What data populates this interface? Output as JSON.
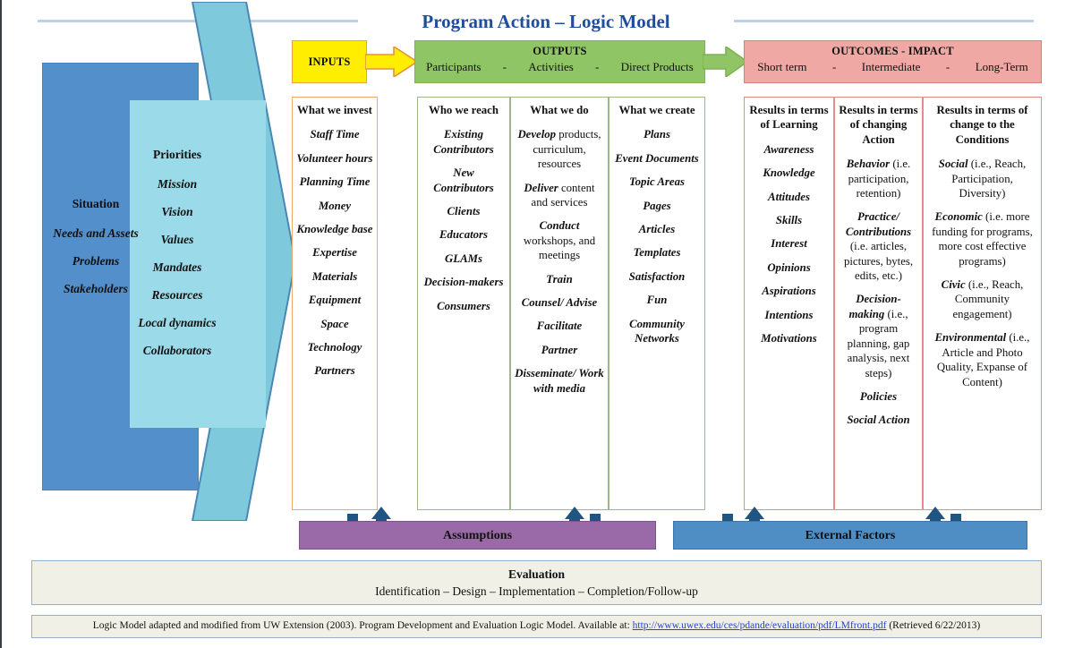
{
  "title": "Program Action – Logic Model",
  "situation": {
    "heading": "Situation",
    "items": [
      "Needs and Assets",
      "Problems",
      "Stakeholders"
    ]
  },
  "priorities": {
    "heading": "Priorities",
    "items": [
      "Mission",
      "Vision",
      "Values",
      "Mandates",
      "Resources",
      "Local dynamics",
      "Collaborators"
    ]
  },
  "headers": {
    "inputs": {
      "title": "INPUTS"
    },
    "outputs": {
      "title": "OUTPUTS",
      "sub": [
        "Participants",
        "-",
        "Activities",
        "-",
        "Direct Products"
      ]
    },
    "outcomes": {
      "title": "OUTCOMES - IMPACT",
      "sub": [
        "Short term",
        "-",
        "Intermediate",
        "-",
        "Long-Term"
      ]
    }
  },
  "columns": {
    "invest": {
      "heading": "What we invest",
      "items": [
        "Staff Time",
        "Volunteer hours",
        "Planning Time",
        "Money",
        "Knowledge base",
        "Expertise",
        "Materials",
        "Equipment",
        "Space",
        "Technology",
        "Partners"
      ]
    },
    "reach": {
      "heading": "Who we reach",
      "items": [
        "Existing Contributors",
        "New Contributors",
        "Clients",
        "Educators",
        "GLAMs",
        "Decision-makers",
        "Consumers"
      ]
    },
    "do": {
      "heading": "What we do",
      "items": [
        {
          "lead": "Develop",
          "rest": "products, curriculum, resources"
        },
        {
          "lead": "Deliver",
          "rest": "content and services"
        },
        {
          "lead": "Conduct",
          "rest": "workshops, and meetings"
        },
        {
          "lead": "Train",
          "rest": ""
        },
        {
          "lead": "Counsel/ Advise",
          "rest": ""
        },
        {
          "lead": "Facilitate",
          "rest": ""
        },
        {
          "lead": "Partner",
          "rest": ""
        },
        {
          "lead": "Disseminate/ Work with media",
          "rest": ""
        }
      ]
    },
    "create": {
      "heading": "What we create",
      "items": [
        "Plans",
        "Event Documents",
        "Topic Areas",
        "Pages",
        "Articles",
        "Templates",
        "Satisfaction",
        "Fun",
        "Community Networks"
      ]
    },
    "learning": {
      "heading": "Results in terms of Learning",
      "items": [
        "Awareness",
        "Knowledge",
        "Attitudes",
        "Skills",
        "Interest",
        "Opinions",
        "Aspirations",
        "Intentions",
        "Motivations"
      ]
    },
    "action": {
      "heading": "Results in terms of changing Action",
      "items": [
        {
          "lead": "Behavior",
          "rest": "(i.e. participation, retention)"
        },
        {
          "lead": "Practice/ Contributions",
          "rest": "(i.e. articles, pictures, bytes, edits, etc.)"
        },
        {
          "lead": "Decision-making",
          "rest": "(i.e., program planning, gap analysis, next steps)"
        },
        {
          "lead": "Policies",
          "rest": ""
        },
        {
          "lead": "Social Action",
          "rest": ""
        }
      ]
    },
    "conditions": {
      "heading": "Results in terms of change to the Conditions",
      "items": [
        {
          "lead": "Social",
          "rest": "(i.e.,  Reach, Participation, Diversity)"
        },
        {
          "lead": "Economic",
          "rest": "(i.e. more funding for programs, more cost effective programs)"
        },
        {
          "lead": "Civic",
          "rest": "(i.e., Reach, Community engagement)"
        },
        {
          "lead": "Environmental",
          "rest": "(i.e., Article and Photo Quality, Expanse of Content)"
        }
      ]
    }
  },
  "bars": {
    "assumptions": "Assumptions",
    "external_factors": "External Factors"
  },
  "evaluation": {
    "title": "Evaluation",
    "steps": "Identification – Design – Implementation – Completion/Follow-up"
  },
  "citation": {
    "before": "Logic Model adapted and modified from UW Extension (2003). Program Development and Evaluation Logic Model. Available at:",
    "link": "http://www.uwex.edu/ces/pdande/evaluation/pdf/LMfront.pdf",
    "after": "(Retrieved 6/22/2013)"
  },
  "colors": {
    "title": "#1f4e9c",
    "inputs": "#ffee00",
    "outputs": "#90c565",
    "outcomes": "#efa8a3",
    "situation": "#538fcb",
    "priorities": "#8ed4e0",
    "assumptions": "#9a69a8",
    "external": "#4e8ec4",
    "evaluation": "#f1f0e6",
    "link": "#2a3fd0",
    "arrow_connector": "#1f5582"
  }
}
